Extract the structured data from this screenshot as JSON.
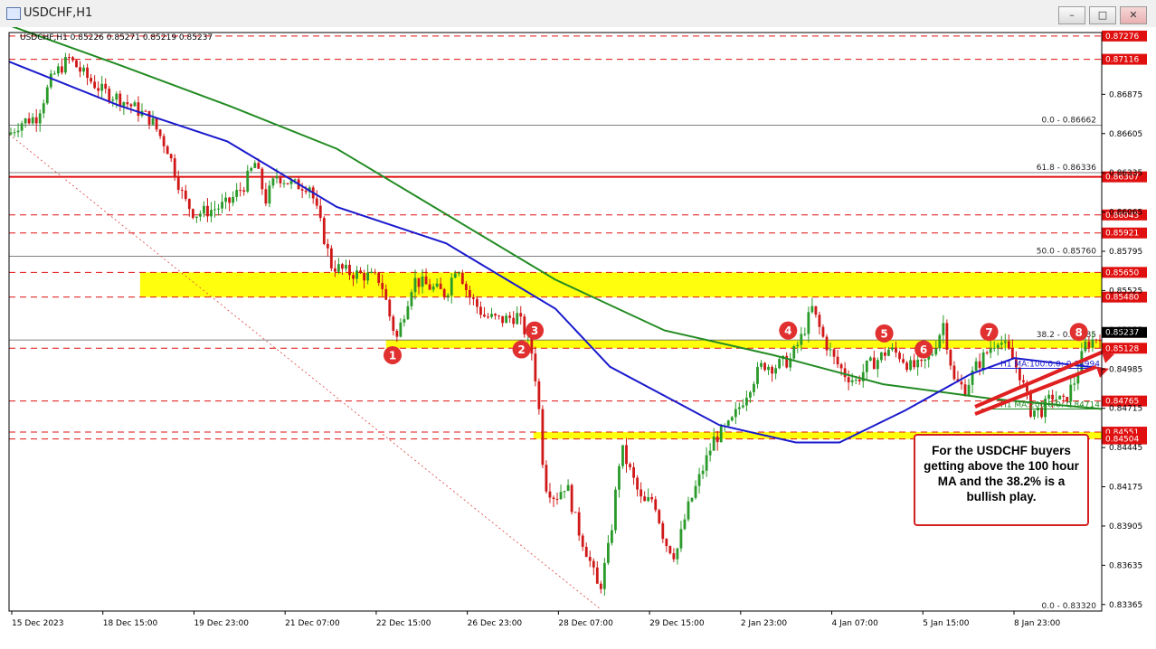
{
  "window": {
    "title": "USDCHF,H1"
  },
  "header": {
    "info": "USDCHF,H1  0.85226 0.85271 0.85219 0.85237"
  },
  "chart_data": {
    "type": "candlestick",
    "symbol": "USDCHF",
    "timeframe": "H1",
    "ylim": [
      0.8332,
      0.873
    ],
    "price_ticks": [
      "0.86875",
      "0.86605",
      "0.86335",
      "0.86065",
      "0.85795",
      "0.85525",
      "0.85255",
      "0.84985",
      "0.84715",
      "0.84445",
      "0.84175",
      "0.83905",
      "0.83635",
      "0.83365"
    ],
    "date_ticks": [
      "15 Dec 2023",
      "18 Dec 15:00",
      "19 Dec 23:00",
      "21 Dec 07:00",
      "22 Dec 15:00",
      "26 Dec 23:00",
      "28 Dec 07:00",
      "29 Dec 15:00",
      "2 Jan 23:00",
      "4 Jan 07:00",
      "5 Jan 15:00",
      "8 Jan 23:00"
    ],
    "close_path": [
      [
        0,
        0.866
      ],
      [
        0.01,
        0.8668
      ],
      [
        0.025,
        0.8672
      ],
      [
        0.04,
        0.87
      ],
      [
        0.055,
        0.8712
      ],
      [
        0.07,
        0.87
      ],
      [
        0.085,
        0.869
      ],
      [
        0.1,
        0.8685
      ],
      [
        0.115,
        0.8678
      ],
      [
        0.13,
        0.867
      ],
      [
        0.145,
        0.865
      ],
      [
        0.16,
        0.8615
      ],
      [
        0.17,
        0.8605
      ],
      [
        0.185,
        0.8608
      ],
      [
        0.2,
        0.8612
      ],
      [
        0.215,
        0.8625
      ],
      [
        0.225,
        0.864
      ],
      [
        0.235,
        0.8615
      ],
      [
        0.245,
        0.8632
      ],
      [
        0.26,
        0.8625
      ],
      [
        0.275,
        0.8625
      ],
      [
        0.285,
        0.8598
      ],
      [
        0.295,
        0.857
      ],
      [
        0.31,
        0.8565
      ],
      [
        0.325,
        0.8563
      ],
      [
        0.34,
        0.856
      ],
      [
        0.35,
        0.853
      ],
      [
        0.355,
        0.852
      ],
      [
        0.37,
        0.856
      ],
      [
        0.385,
        0.8555
      ],
      [
        0.4,
        0.855
      ],
      [
        0.41,
        0.8572
      ],
      [
        0.42,
        0.855
      ],
      [
        0.435,
        0.8535
      ],
      [
        0.45,
        0.8532
      ],
      [
        0.465,
        0.8535
      ],
      [
        0.475,
        0.852
      ],
      [
        0.48,
        0.8505
      ],
      [
        0.485,
        0.847
      ],
      [
        0.49,
        0.842
      ],
      [
        0.5,
        0.841
      ],
      [
        0.51,
        0.842
      ],
      [
        0.52,
        0.839
      ],
      [
        0.53,
        0.837
      ],
      [
        0.54,
        0.8345
      ],
      [
        0.55,
        0.838
      ],
      [
        0.56,
        0.8445
      ],
      [
        0.57,
        0.8425
      ],
      [
        0.58,
        0.8405
      ],
      [
        0.59,
        0.841
      ],
      [
        0.6,
        0.838
      ],
      [
        0.61,
        0.837
      ],
      [
        0.62,
        0.84
      ],
      [
        0.63,
        0.842
      ],
      [
        0.645,
        0.845
      ],
      [
        0.66,
        0.846
      ],
      [
        0.67,
        0.8475
      ],
      [
        0.68,
        0.849
      ],
      [
        0.69,
        0.8502
      ],
      [
        0.7,
        0.85
      ],
      [
        0.715,
        0.8505
      ],
      [
        0.725,
        0.852
      ],
      [
        0.735,
        0.854
      ],
      [
        0.745,
        0.852
      ],
      [
        0.755,
        0.8505
      ],
      [
        0.765,
        0.8495
      ],
      [
        0.775,
        0.849
      ],
      [
        0.785,
        0.85
      ],
      [
        0.795,
        0.8505
      ],
      [
        0.805,
        0.8512
      ],
      [
        0.815,
        0.8508
      ],
      [
        0.825,
        0.85
      ],
      [
        0.835,
        0.85
      ],
      [
        0.845,
        0.851
      ],
      [
        0.855,
        0.853
      ],
      [
        0.865,
        0.849
      ],
      [
        0.875,
        0.8485
      ],
      [
        0.885,
        0.85
      ],
      [
        0.895,
        0.851
      ],
      [
        0.905,
        0.852
      ],
      [
        0.915,
        0.851
      ],
      [
        0.925,
        0.8495
      ],
      [
        0.935,
        0.847
      ],
      [
        0.945,
        0.847
      ],
      [
        0.955,
        0.848
      ],
      [
        0.965,
        0.8475
      ],
      [
        0.975,
        0.849
      ],
      [
        0.985,
        0.8515
      ],
      [
        0.995,
        0.852
      ],
      [
        1,
        0.8524
      ]
    ],
    "ma200": {
      "label": "H1 MA:200:0:0: 0.84714",
      "color": "#228b22",
      "points": [
        [
          0,
          0.8735
        ],
        [
          0.1,
          0.8708
        ],
        [
          0.2,
          0.868
        ],
        [
          0.3,
          0.865
        ],
        [
          0.4,
          0.8605
        ],
        [
          0.5,
          0.856
        ],
        [
          0.6,
          0.8525
        ],
        [
          0.7,
          0.8508
        ],
        [
          0.8,
          0.8488
        ],
        [
          0.9,
          0.8478
        ],
        [
          1,
          0.8471
        ]
      ]
    },
    "ma100": {
      "label": "H1 MA:100:0:0: 0.84994",
      "color": "#1a1acd",
      "points": [
        [
          0,
          0.871
        ],
        [
          0.1,
          0.868
        ],
        [
          0.2,
          0.8655
        ],
        [
          0.3,
          0.861
        ],
        [
          0.4,
          0.8585
        ],
        [
          0.5,
          0.854
        ],
        [
          0.55,
          0.85
        ],
        [
          0.65,
          0.846
        ],
        [
          0.72,
          0.8448
        ],
        [
          0.76,
          0.8448
        ],
        [
          0.82,
          0.847
        ],
        [
          0.88,
          0.8495
        ],
        [
          0.92,
          0.8506
        ],
        [
          1,
          0.8499
        ]
      ]
    },
    "fib_levels": [
      {
        "label": "0.0 - 0.86662",
        "value": 0.86662
      },
      {
        "label": "61.8 - 0.86336",
        "value": 0.86336
      },
      {
        "label": "50.0 - 0.85760",
        "value": 0.8576
      },
      {
        "label": "38.2 - 0.85185",
        "value": 0.85185
      },
      {
        "label": "0.0 - 0.83320",
        "value": 0.8332
      }
    ],
    "red_levels": [
      {
        "label": "0.87276",
        "value": 0.87276,
        "style": "dashed"
      },
      {
        "label": "0.87116",
        "value": 0.87116,
        "style": "dashed"
      },
      {
        "label": "0.86307",
        "value": 0.86307,
        "style": "solid"
      },
      {
        "label": "0.86045",
        "value": 0.86045,
        "style": "dashed"
      },
      {
        "label": "0.85921",
        "value": 0.85921,
        "style": "dashed"
      },
      {
        "label": "0.85650",
        "value": 0.8565,
        "style": "dashed"
      },
      {
        "label": "0.85480",
        "value": 0.8548,
        "style": "dashed"
      },
      {
        "label": "0.85128",
        "value": 0.85128,
        "style": "dashed"
      },
      {
        "label": "0.84765",
        "value": 0.84765,
        "style": "dashed"
      },
      {
        "label": "0.84551",
        "value": 0.84551,
        "style": "dashed"
      },
      {
        "label": "0.84504",
        "value": 0.84504,
        "style": "dashed"
      }
    ],
    "current_price": "0.85237",
    "zones": [
      {
        "name": "upper",
        "top": 0.8565,
        "bottom": 0.8548,
        "start": 0.12
      },
      {
        "name": "middle",
        "top": 0.85185,
        "bottom": 0.85128,
        "start": 0.345
      },
      {
        "name": "lower",
        "top": 0.84551,
        "bottom": 0.84504,
        "start": 0.48
      }
    ],
    "markers": [
      {
        "n": "1",
        "x": 0.351,
        "y": 0.8508
      },
      {
        "n": "2",
        "x": 0.469,
        "y": 0.8512
      },
      {
        "n": "3",
        "x": 0.481,
        "y": 0.8525
      },
      {
        "n": "4",
        "x": 0.713,
        "y": 0.8525
      },
      {
        "n": "5",
        "x": 0.801,
        "y": 0.8523
      },
      {
        "n": "6",
        "x": 0.837,
        "y": 0.8512
      },
      {
        "n": "7",
        "x": 0.897,
        "y": 0.8524
      },
      {
        "n": "8",
        "x": 0.979,
        "y": 0.8524
      }
    ]
  },
  "annotation": {
    "text": "For the USDCHF buyers getting above the 100 hour MA and the 38.2% is a bullish play."
  }
}
